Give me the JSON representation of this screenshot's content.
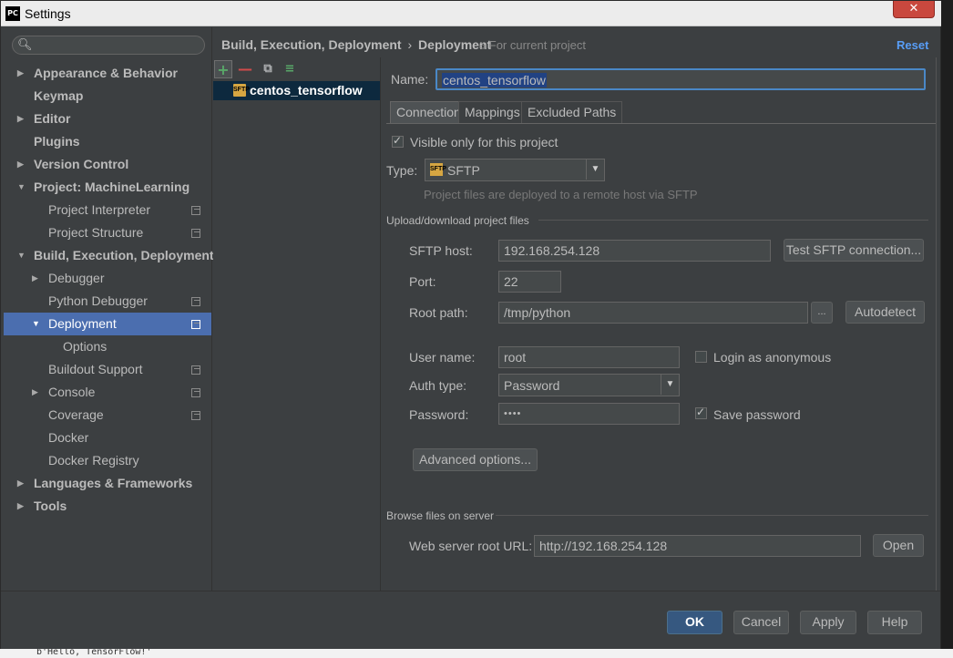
{
  "window": {
    "app_icon": "PC",
    "title": "Settings",
    "close_label": "✕"
  },
  "search": {
    "icon": "search-icon",
    "placeholder": ""
  },
  "tree": {
    "items": [
      {
        "label": "Appearance & Behavior",
        "bold": true,
        "expand": "collapsed",
        "level": 0
      },
      {
        "label": "Keymap",
        "bold": true,
        "expand": "none",
        "level": 0
      },
      {
        "label": "Editor",
        "bold": true,
        "expand": "collapsed",
        "level": 0
      },
      {
        "label": "Plugins",
        "bold": true,
        "expand": "none",
        "level": 0
      },
      {
        "label": "Version Control",
        "bold": true,
        "expand": "collapsed",
        "level": 0
      },
      {
        "label": "Project: MachineLearning",
        "bold": true,
        "expand": "expanded",
        "level": 0
      },
      {
        "label": "Project Interpreter",
        "bold": false,
        "expand": "none",
        "level": 1,
        "project_icon": true
      },
      {
        "label": "Project Structure",
        "bold": false,
        "expand": "none",
        "level": 1,
        "project_icon": true
      },
      {
        "label": "Build, Execution, Deployment",
        "bold": true,
        "expand": "expanded",
        "level": 0
      },
      {
        "label": "Debugger",
        "bold": false,
        "expand": "collapsed",
        "level": 1
      },
      {
        "label": "Python Debugger",
        "bold": false,
        "expand": "none",
        "level": 1,
        "project_icon": true
      },
      {
        "label": "Deployment",
        "bold": false,
        "expand": "expanded",
        "level": 1,
        "project_icon": true,
        "selected": true
      },
      {
        "label": "Options",
        "bold": false,
        "expand": "none",
        "level": 2
      },
      {
        "label": "Buildout Support",
        "bold": false,
        "expand": "none",
        "level": 1,
        "project_icon": true
      },
      {
        "label": "Console",
        "bold": false,
        "expand": "collapsed",
        "level": 1,
        "project_icon": true
      },
      {
        "label": "Coverage",
        "bold": false,
        "expand": "none",
        "level": 1,
        "project_icon": true
      },
      {
        "label": "Docker",
        "bold": false,
        "expand": "none",
        "level": 1
      },
      {
        "label": "Docker Registry",
        "bold": false,
        "expand": "none",
        "level": 1
      },
      {
        "label": "Languages & Frameworks",
        "bold": true,
        "expand": "collapsed",
        "level": 0
      },
      {
        "label": "Tools",
        "bold": true,
        "expand": "collapsed",
        "level": 0
      }
    ]
  },
  "header": {
    "breadcrumb_parent": "Build, Execution, Deployment",
    "breadcrumb_sep": "›",
    "breadcrumb_current": "Deployment",
    "scope_icon": "project-scope-icon",
    "scope_label": "For current project",
    "reset_label": "Reset"
  },
  "server_toolbar": {
    "add": "+",
    "remove": "—",
    "copy": "⧉",
    "default": "≡"
  },
  "servers": [
    {
      "icon_text": "SFTP",
      "label": "centos_tensorflow"
    }
  ],
  "form": {
    "name_label": "Name:",
    "name_value": "centos_tensorflow",
    "tabs": [
      "Connection",
      "Mappings",
      "Excluded Paths"
    ],
    "active_tab": "Connection",
    "visible_only_label": "Visible only for this project",
    "visible_only_checked": true,
    "type_label": "Type:",
    "type_value": "SFTP",
    "type_icon_text": "SFTP",
    "type_hint": "Project files are deployed to a remote host via SFTP",
    "upload_section": "Upload/download project files",
    "host_label": "SFTP host:",
    "host_value": "192.168.254.128",
    "test_button": "Test SFTP connection...",
    "port_label": "Port:",
    "port_value": "22",
    "root_label": "Root path:",
    "root_value": "/tmp/python",
    "browse_button": "...",
    "autodetect_button": "Autodetect",
    "user_label": "User name:",
    "user_value": "root",
    "anon_label": "Login as anonymous",
    "anon_checked": false,
    "auth_label": "Auth type:",
    "auth_value": "Password",
    "password_label": "Password:",
    "password_value": "••••",
    "save_password_label": "Save password",
    "save_password_checked": true,
    "advanced_button": "Advanced options...",
    "browse_section": "Browse files on server",
    "web_url_label": "Web server root URL:",
    "web_url_value": "http://192.168.254.128",
    "open_button": "Open"
  },
  "footer": {
    "ok": "OK",
    "cancel": "Cancel",
    "apply": "Apply",
    "help": "Help"
  },
  "background_console": "b'Hello, TensorFlow!'"
}
